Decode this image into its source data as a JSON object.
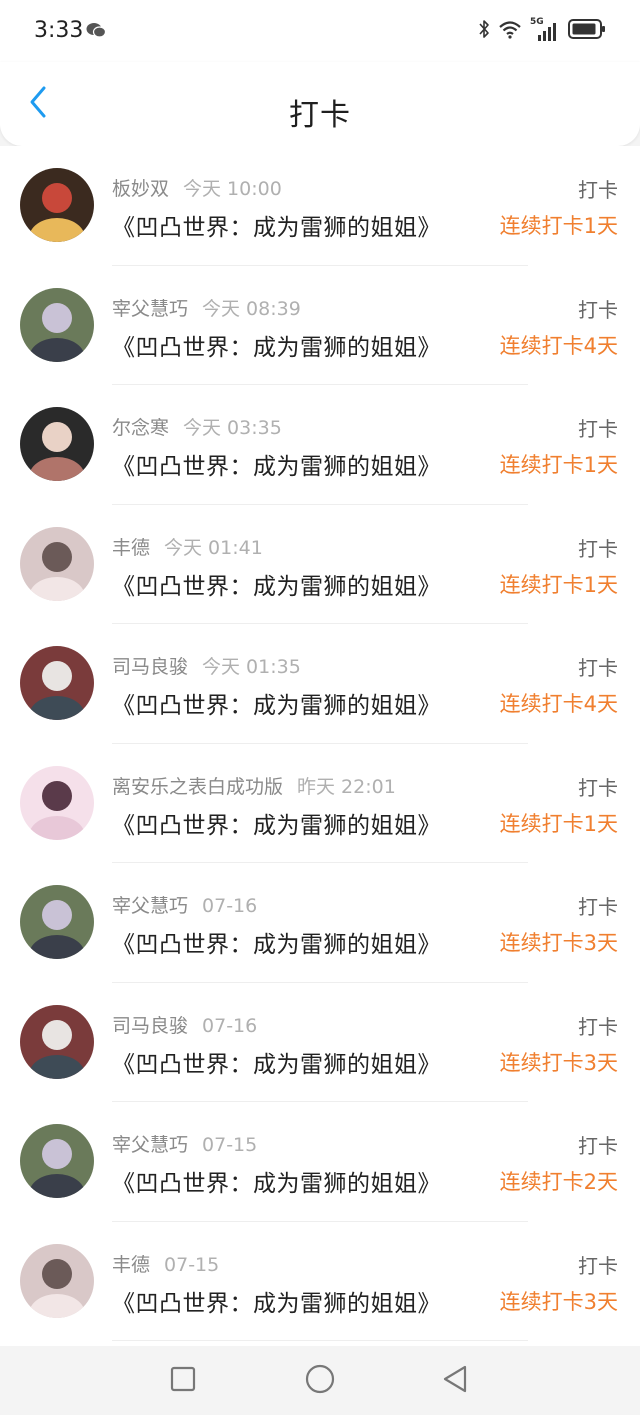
{
  "status_bar": {
    "time": "3:33",
    "icons": [
      "wechat-icon",
      "bluetooth-icon",
      "wifi-icon",
      "5g-signal-icon",
      "battery-icon"
    ],
    "network_label": "5G"
  },
  "header": {
    "title": "打卡",
    "back_icon": "chevron-left-icon"
  },
  "accent_color": "#f07f2f",
  "back_color": "#1e9bf0",
  "checkins": [
    {
      "user": "板妙双",
      "time": "今天 10:00",
      "book": "《凹凸世界：成为雷狮的姐姐》",
      "action": "打卡",
      "streak": "连续打卡1天"
    },
    {
      "user": "宰父慧巧",
      "time": "今天 08:39",
      "book": "《凹凸世界：成为雷狮的姐姐》",
      "action": "打卡",
      "streak": "连续打卡4天"
    },
    {
      "user": "尔念寒",
      "time": "今天 03:35",
      "book": "《凹凸世界：成为雷狮的姐姐》",
      "action": "打卡",
      "streak": "连续打卡1天"
    },
    {
      "user": "丰德",
      "time": "今天 01:41",
      "book": "《凹凸世界：成为雷狮的姐姐》",
      "action": "打卡",
      "streak": "连续打卡1天"
    },
    {
      "user": "司马良骏",
      "time": "今天 01:35",
      "book": "《凹凸世界：成为雷狮的姐姐》",
      "action": "打卡",
      "streak": "连续打卡4天"
    },
    {
      "user": "离安乐之表白成功版",
      "time": "昨天 22:01",
      "book": "《凹凸世界：成为雷狮的姐姐》",
      "action": "打卡",
      "streak": "连续打卡1天"
    },
    {
      "user": "宰父慧巧",
      "time": "07-16",
      "book": "《凹凸世界：成为雷狮的姐姐》",
      "action": "打卡",
      "streak": "连续打卡3天"
    },
    {
      "user": "司马良骏",
      "time": "07-16",
      "book": "《凹凸世界：成为雷狮的姐姐》",
      "action": "打卡",
      "streak": "连续打卡3天"
    },
    {
      "user": "宰父慧巧",
      "time": "07-15",
      "book": "《凹凸世界：成为雷狮的姐姐》",
      "action": "打卡",
      "streak": "连续打卡2天"
    },
    {
      "user": "丰德",
      "time": "07-15",
      "book": "《凹凸世界：成为雷狮的姐姐》",
      "action": "打卡",
      "streak": "连续打卡3天"
    }
  ],
  "nav_bar": {
    "buttons": [
      "recents-square-icon",
      "home-circle-icon",
      "back-triangle-icon"
    ]
  }
}
